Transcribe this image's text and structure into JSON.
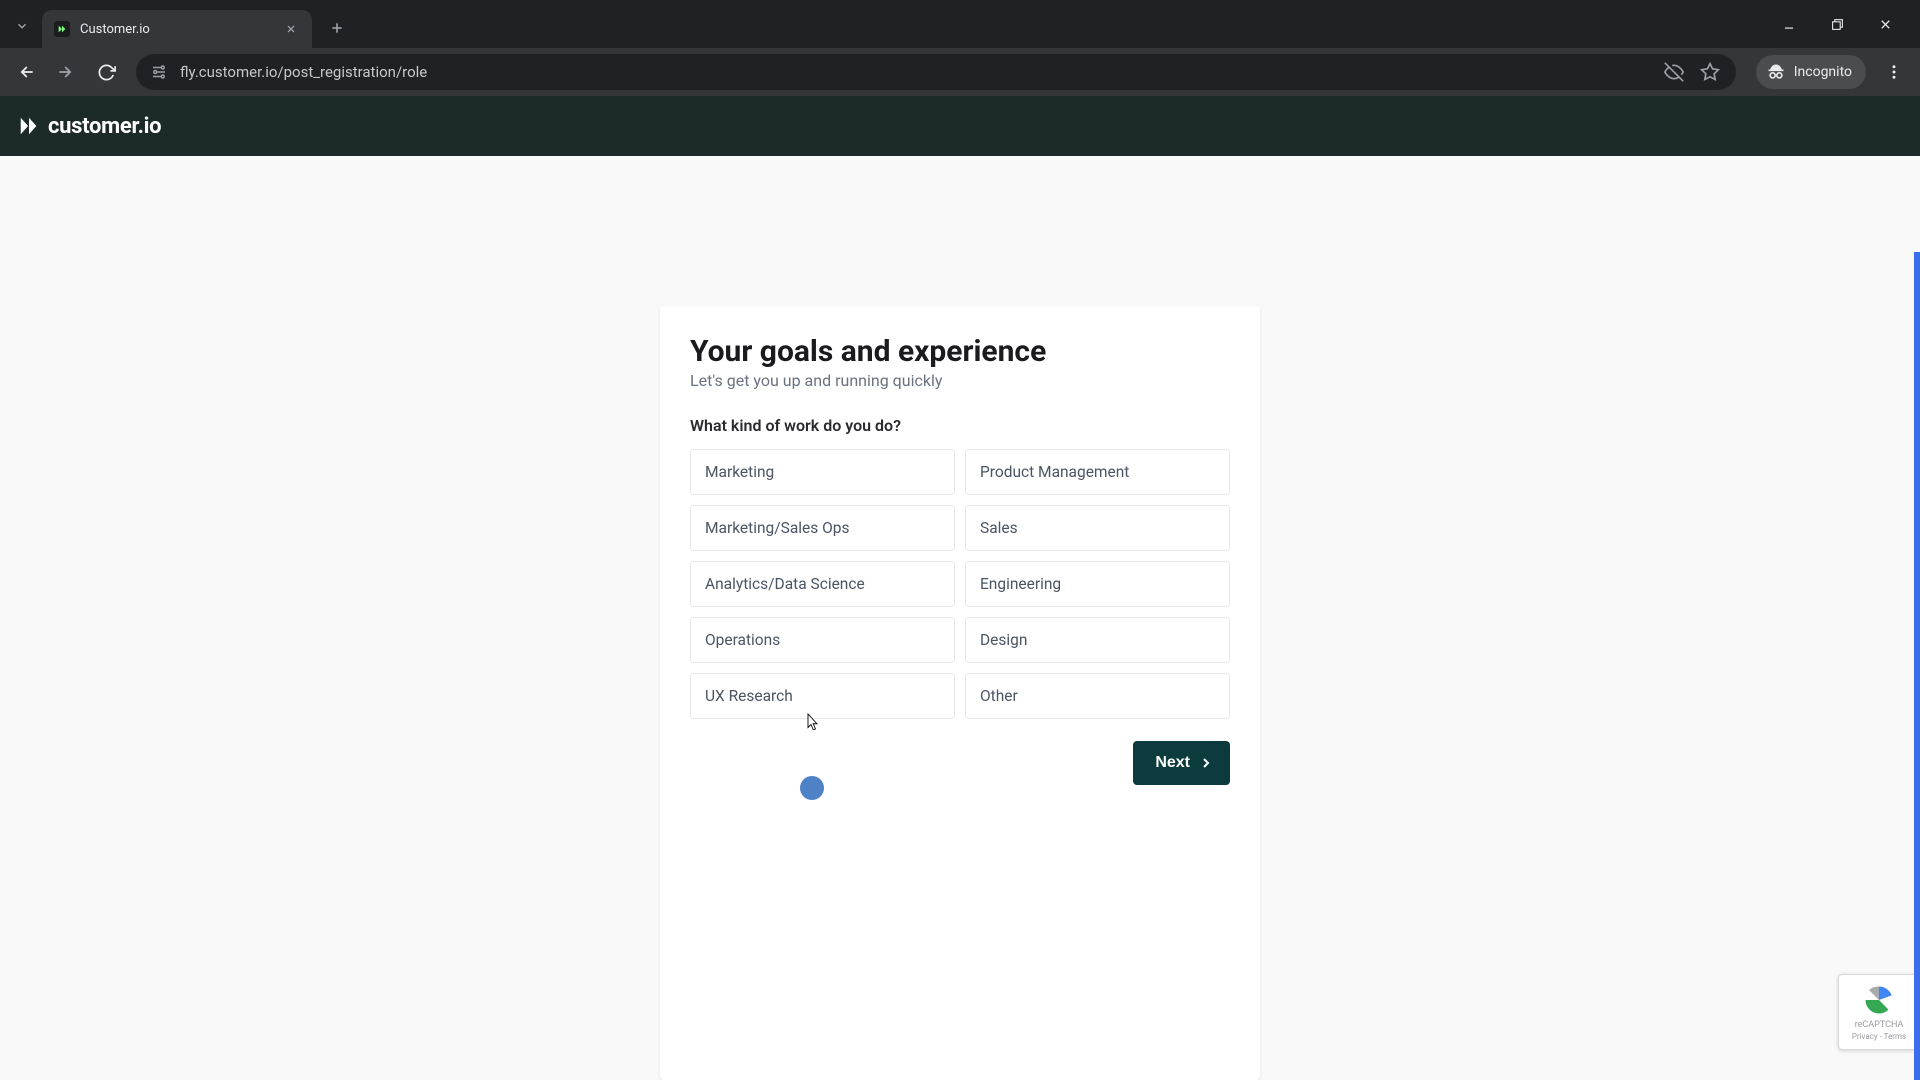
{
  "browser": {
    "tab_title": "Customer.io",
    "url_display": "fly.customer.io/post_registration/role",
    "incognito_label": "Incognito"
  },
  "app": {
    "brand": "customer.io"
  },
  "card": {
    "heading": "Your goals and experience",
    "subheading": "Let's get you up and running quickly",
    "question": "What kind of work do you do?",
    "options": [
      "Marketing",
      "Product Management",
      "Marketing/Sales Ops",
      "Sales",
      "Analytics/Data Science",
      "Engineering",
      "Operations",
      "Design",
      "UX Research",
      "Other"
    ],
    "next_label": "Next"
  },
  "recaptcha": {
    "label": "reCAPTCHA",
    "links": "Privacy - Terms"
  }
}
